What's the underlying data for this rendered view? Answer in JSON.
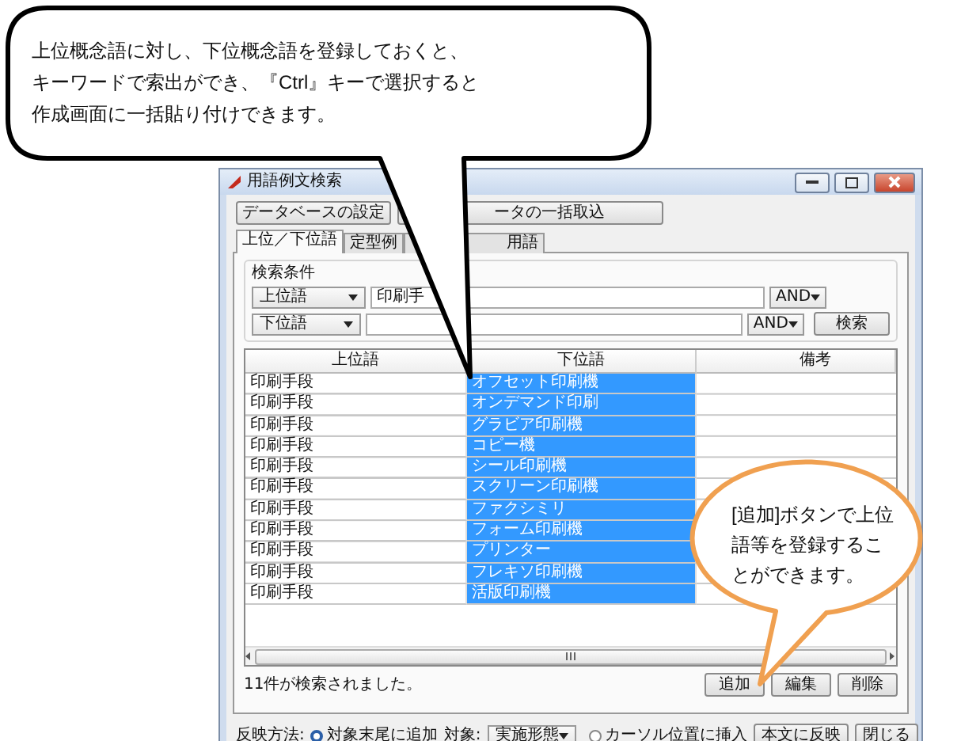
{
  "callouts": [
    {
      "kind": "speech",
      "text": "上位概念語に対し、下位概念語を登録しておくと、キーワードで索出ができ、『Ctrl』キーで選択すると作成画面に一括貼り付けできます。"
    },
    {
      "kind": "note",
      "text": "[追加]ボタンで上位語等を登録することができます。"
    }
  ],
  "window": {
    "title": "用語例文検索",
    "toolbar_buttons": [
      "データベースの設定",
      "ータの一括取込"
    ],
    "tabs": [
      {
        "label": "上位／下位語",
        "selected": true
      },
      {
        "label": "定型例",
        "selected": false
      },
      {
        "label": "用語",
        "selected": false
      }
    ],
    "search": {
      "label": "検索条件",
      "button": "検索",
      "rows": [
        {
          "field": "上位語",
          "value": "印刷手",
          "operator": "AND"
        },
        {
          "field": "下位語",
          "operator": "AND"
        }
      ]
    },
    "table": {
      "columns": [
        "上位語",
        "下位語",
        "備考"
      ],
      "rows": [
        {
          "upper": "印刷手段",
          "lower": "オフセット印刷機",
          "selected": true
        },
        {
          "upper": "印刷手段",
          "lower": "オンデマンド印刷",
          "selected": true
        },
        {
          "upper": "印刷手段",
          "lower": "グラビア印刷機",
          "selected": true
        },
        {
          "upper": "印刷手段",
          "lower": "コピー機",
          "selected": true
        },
        {
          "upper": "印刷手段",
          "lower": "シール印刷機",
          "selected": true
        },
        {
          "upper": "印刷手段",
          "lower": "スクリーン印刷機",
          "selected": true
        },
        {
          "upper": "印刷手段",
          "lower": "ファクシミリ",
          "selected": true
        },
        {
          "upper": "印刷手段",
          "lower": "フォーム印刷機",
          "selected": true
        },
        {
          "upper": "印刷手段",
          "lower": "プリンター",
          "selected": true
        },
        {
          "upper": "印刷手段",
          "lower": "フレキソ印刷機",
          "selected": true
        },
        {
          "upper": "印刷手段",
          "lower": "活版印刷機",
          "selected": true
        }
      ]
    },
    "status": "11件が検索されました。",
    "actions": [
      "追加",
      "編集",
      "削除"
    ],
    "footer": {
      "label": "反映方法:",
      "options": [
        {
          "label": "対象末尾に追加",
          "selected": true
        },
        {
          "label": "カーソル位置に挿入",
          "selected": false
        }
      ],
      "target_label": "対象:",
      "target_value": "実施形態",
      "buttons": [
        "本文に反映",
        "閉じる"
      ]
    }
  }
}
